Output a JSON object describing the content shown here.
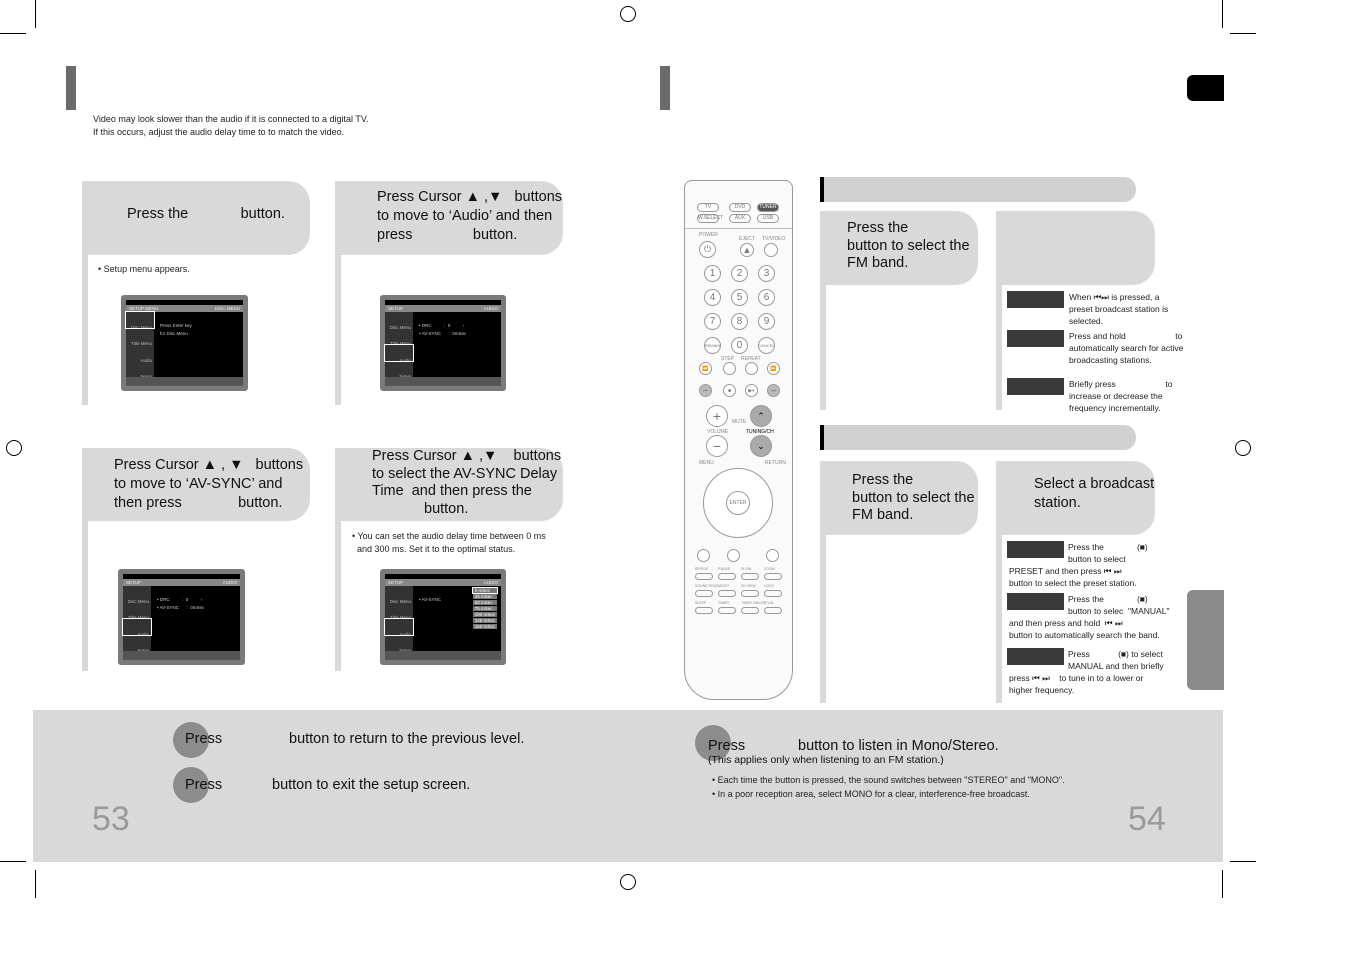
{
  "left_page": {
    "intro": [
      "Video may look slower than the audio if it is connected to a digital TV.",
      "If this occurs, adjust the audio delay time to to match the video."
    ],
    "steps": [
      {
        "lines": [
          "Press the             button."
        ],
        "note": "Setup menu appears."
      },
      {
        "lines": [
          "Press Cursor ▲ ,▼   buttons",
          "to move to ‘Audio’ and then",
          "press               button."
        ]
      },
      {
        "lines": [
          "Press Cursor ▲ , ▼   buttons",
          "to move to ‘AV-SYNC’ and",
          "then press              button."
        ]
      },
      {
        "lines": [
          "Press Cursor ▲ ,▼    buttons",
          "to select the AV-SYNC Delay",
          "Time  and then press the",
          "button."
        ],
        "note": [
          "You can set the audio delay time between 0 ms",
          "and 300 ms. Set it to the optimal status."
        ]
      }
    ],
    "screens": [
      {
        "left": "SETUP MENU",
        "right": "DISC MENU",
        "menu": [
          "Disc Menu",
          "Title Menu",
          "Audio",
          "Setup"
        ],
        "sel": 0,
        "text": [
          "Press Enter key",
          "for Disc Menu"
        ]
      },
      {
        "left": "SETUP",
        "right": "AUDIO",
        "menu": [
          "Disc Menu",
          "Title Menu",
          "Audio",
          "Setup"
        ],
        "sel": 2,
        "text": [
          "• DRC          :  0          ›",
          "• AV-SYNC      :  0mSec"
        ]
      },
      {
        "left": "SETUP",
        "right": "AUDIO",
        "menu": [
          "Disc Menu",
          "Title Menu",
          "Audio",
          "Setup"
        ],
        "sel": 2,
        "text": [
          "• DRC          :  0          ›",
          "• AV-SYNC      :  0mSec"
        ]
      },
      {
        "left": "SETUP",
        "right": "AUDIO",
        "menu": [
          "Disc Menu",
          "Title Menu",
          "Audio",
          "Setup"
        ],
        "sel": 2,
        "text": [
          "• AV-SYNC"
        ],
        "options": [
          "0 mSec",
          "25 mSec",
          "50 mSec",
          "75 mSec",
          "100 mSec",
          "125 mSec",
          "150 mSec"
        ]
      }
    ],
    "bottom": [
      {
        "press": "Press",
        "rest": "button to return to the previous level."
      },
      {
        "press": "Press",
        "rest": "button to exit the setup screen."
      }
    ],
    "page_number": "53"
  },
  "right_page": {
    "step_a": [
      "Press the",
      "button to select the",
      "FM band."
    ],
    "step_a_notes": [
      [
        "When ⏮⏭ is pressed, a",
        "preset broadcast station is",
        "selected."
      ],
      [
        "Press and hold                     to",
        "automatically search for active",
        "broadcasting stations."
      ],
      [
        "Briefly press                     to",
        "increase or decrease the",
        "frequency incrementally."
      ]
    ],
    "step_b": [
      "Press the",
      "button to select the",
      "FM band."
    ],
    "step_c": [
      "Select a broadcast",
      "station."
    ],
    "step_c_notes": [
      [
        "Press the              (■)",
        "button to select",
        "PRESET and then press ⏮ ⏭",
        "button to select the preset station."
      ],
      [
        "Press the              (■)",
        "button to selec  \"MANUAL\"",
        "and then press and hold  ⏮ ⏭",
        "button to automatically search the band."
      ],
      [
        "Press            (■) to select",
        "MANUAL and then briefly",
        "press ⏮ ⏭    to tune in to a lower or",
        "higher frequency."
      ]
    ],
    "bottom": {
      "press": "Press",
      "rest": "button to listen in Mono/Stereo.",
      "sub": "(This applies only when listening to an FM station.)",
      "bullets": [
        "Each time the button is pressed, the sound switches between \"STEREO\" and \"MONO\".",
        "In a poor reception area, select MONO for a clear, interference-free broadcast."
      ]
    },
    "page_number": "54"
  },
  "remote": {
    "sources": [
      "TV",
      "DVD",
      "TUNER",
      "W.SELECT",
      "AUX",
      "USB"
    ],
    "labels": [
      "POWER",
      "EJECT",
      "TV/VIDEO",
      "STEP",
      "REPEAT",
      "MUTE",
      "VOLUME",
      "TUNING/CH",
      "MENU",
      "RETURN",
      "ENTER"
    ],
    "numbers": [
      "1",
      "2",
      "3",
      "4",
      "5",
      "6",
      "7",
      "8",
      "9",
      "REMAIN",
      "0",
      "CANCEL"
    ],
    "bottom_rows": [
      [
        "REPEAT",
        "P.BASS",
        "SLOW",
        "ZOOM"
      ],
      [
        "SOUND EDGE",
        "MO/ST",
        "SD VIEW",
        "LOGO"
      ],
      [
        "SLEEP",
        "TIMER",
        "TIMER ON/OFF",
        "S.VOL"
      ]
    ]
  }
}
